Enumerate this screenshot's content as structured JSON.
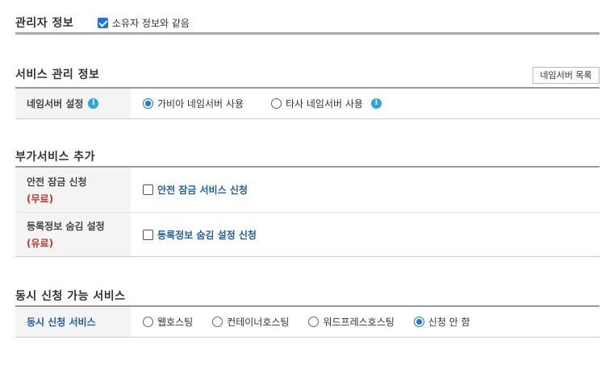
{
  "admin": {
    "title": "관리자 정보",
    "same_as_owner_label": "소유자 정보와 같음",
    "same_as_owner_checked": true
  },
  "service": {
    "title": "서비스 관리 정보",
    "ns_list_button": "네임서버 목록",
    "ns_setting_label": "네임서버 설정",
    "option_gabia": "가비아 네임서버 사용",
    "option_other": "타사 네임서버 사용",
    "selected": "gabia"
  },
  "addon": {
    "title": "부가서비스 추가",
    "rows": [
      {
        "label": "안전 잠금 신청",
        "note": "(무료)",
        "checkbox_label": "안전 잠금 서비스 신청"
      },
      {
        "label": "등록정보 숨김 설정",
        "note": "(유료)",
        "checkbox_label": "등록정보 숨김 설정 신청"
      }
    ]
  },
  "concurrent": {
    "title": "동시 신청 가능 서비스",
    "row_label": "동시 신청 서비스",
    "options": [
      "웹호스팅",
      "컨테이너호스팅",
      "워드프레스호스팅",
      "신청 안 함"
    ],
    "selected_index": 3
  },
  "colors": {
    "accent": "#1a73e8",
    "link": "#1f5fa8",
    "note_red": "#c0392b",
    "info_icon": "#2aa7dc"
  }
}
